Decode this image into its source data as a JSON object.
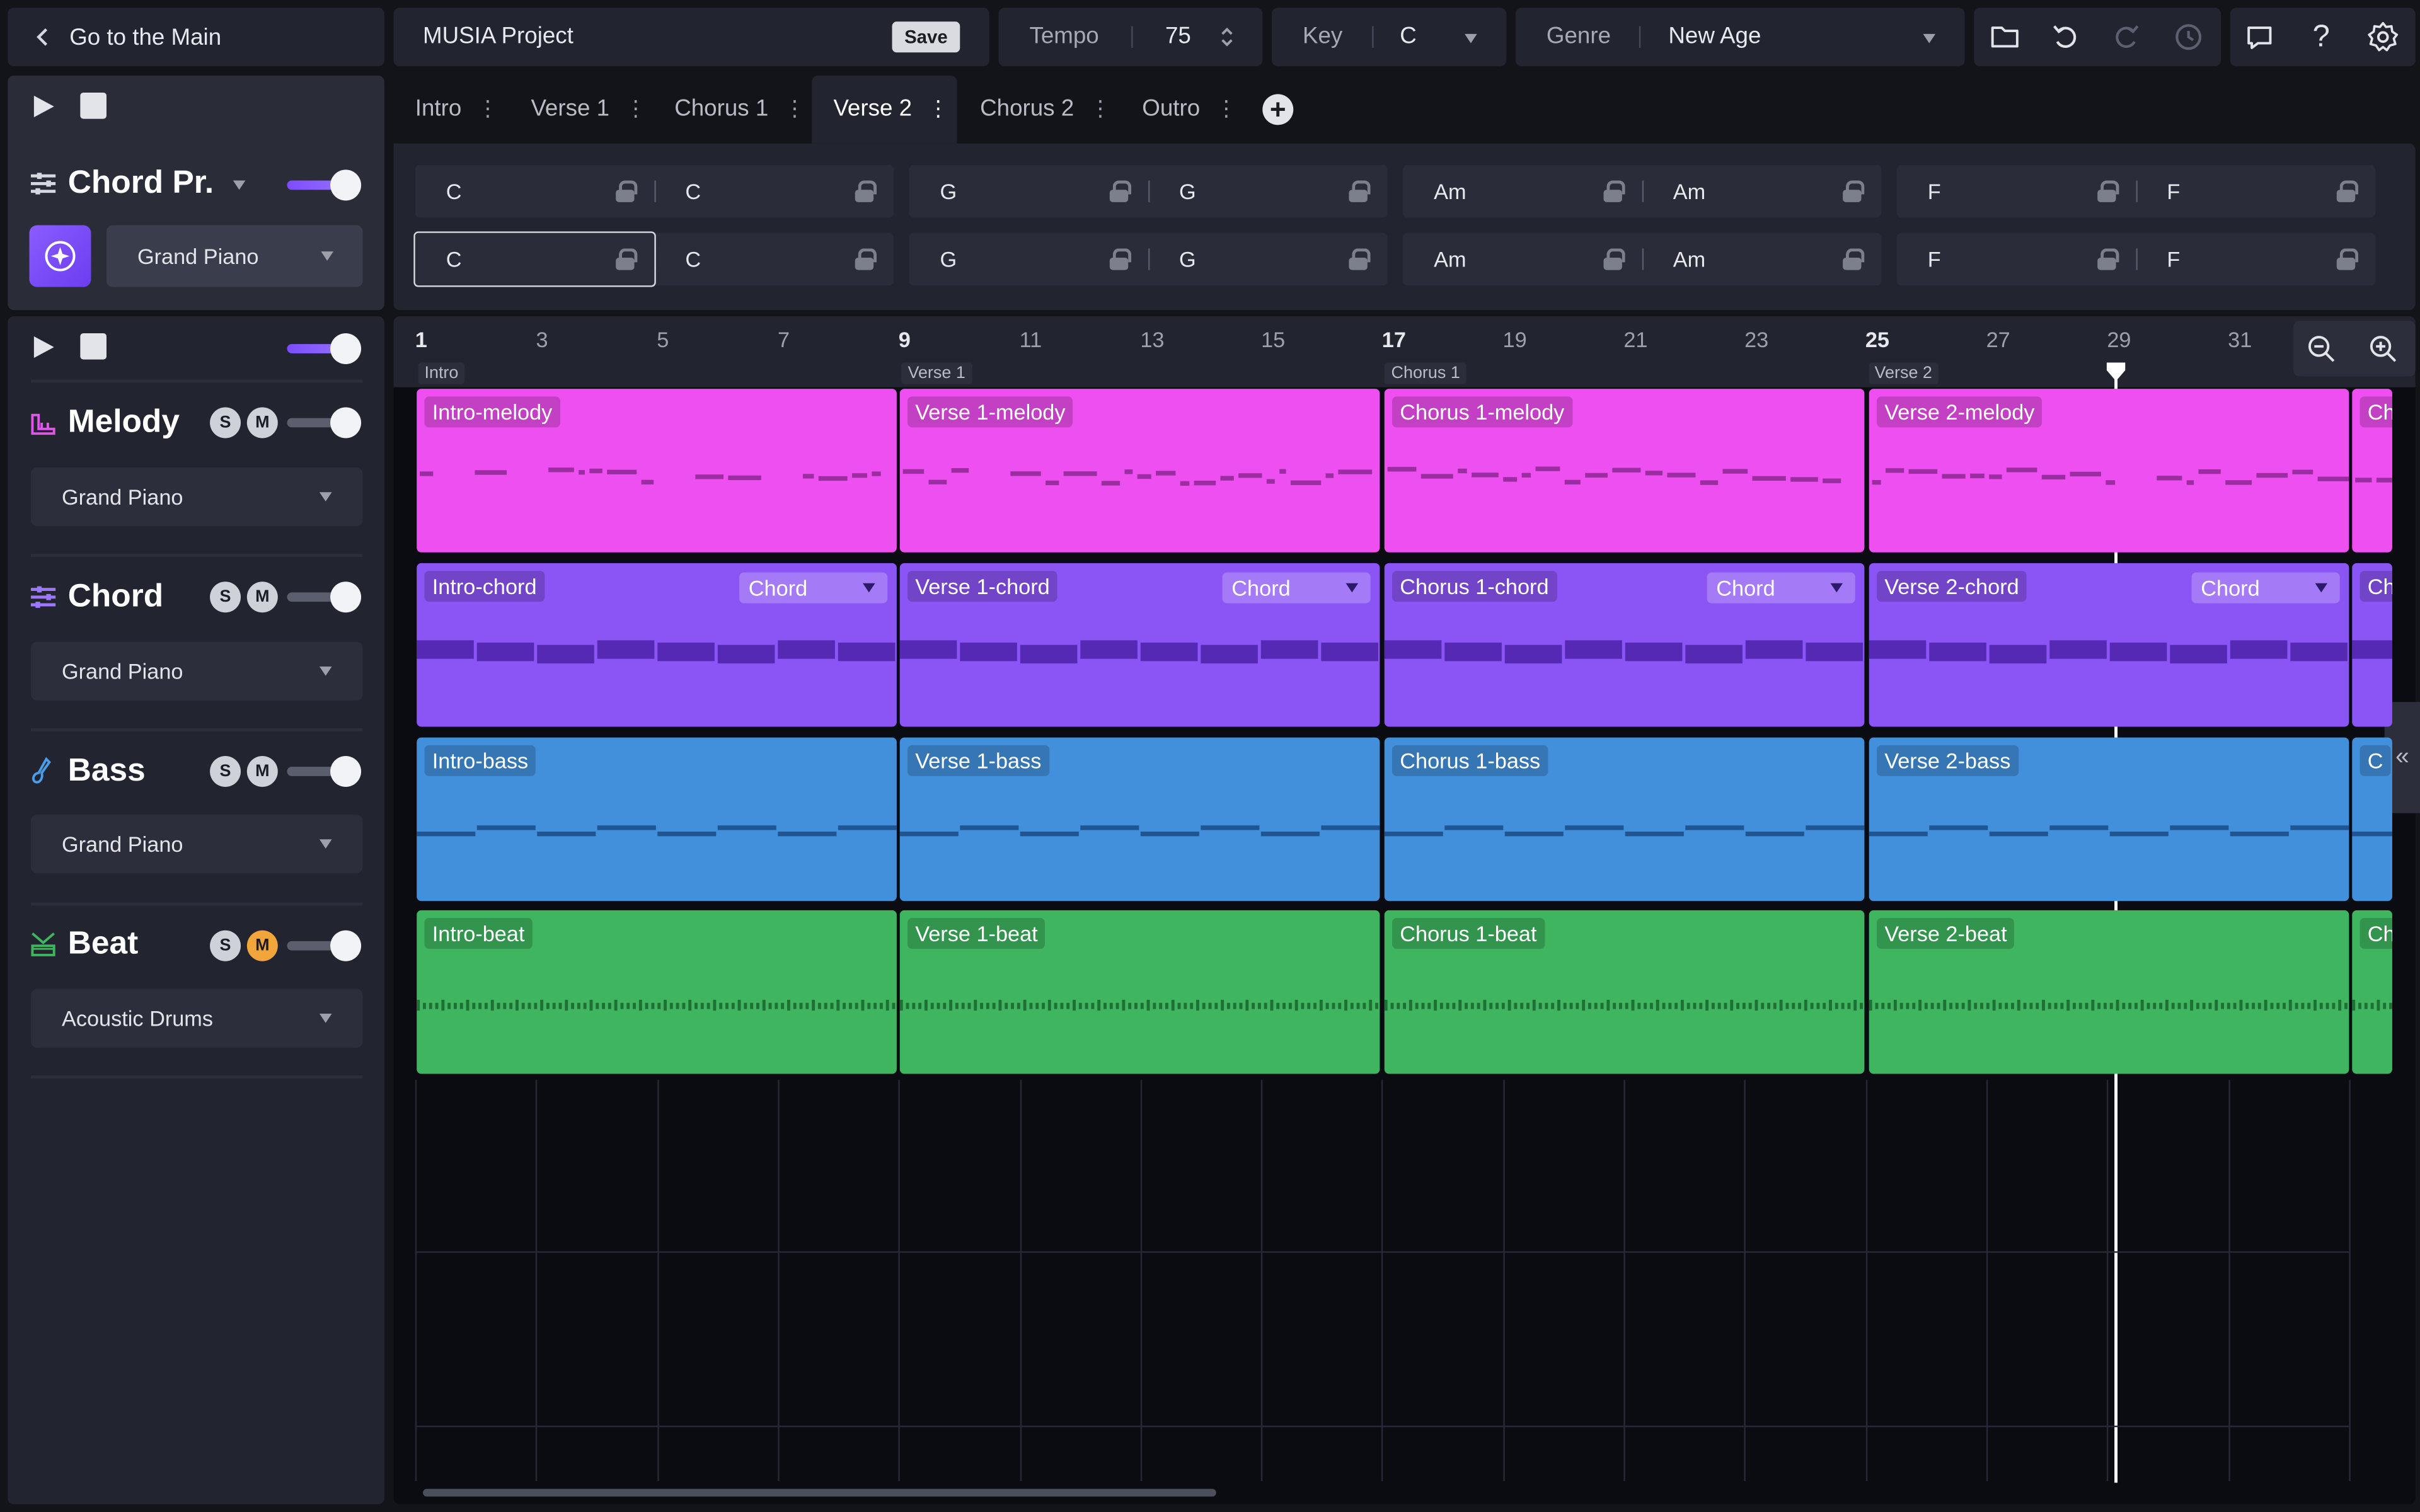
{
  "header": {
    "back_label": "Go to the Main",
    "project_name": "MUSIA Project",
    "save_label": "Save",
    "tempo_label": "Tempo",
    "tempo_value": "75",
    "key_label": "Key",
    "key_value": "C",
    "genre_label": "Genre",
    "genre_value": "New Age"
  },
  "tabs": [
    {
      "label": "Intro"
    },
    {
      "label": "Verse 1"
    },
    {
      "label": "Chorus 1"
    },
    {
      "label": "Verse 2",
      "active": true
    },
    {
      "label": "Chorus 2"
    },
    {
      "label": "Outro"
    }
  ],
  "chord_progression": {
    "title": "Chord Pr.",
    "instrument": "Grand Piano",
    "rows": [
      [
        "C",
        "C",
        "G",
        "G",
        "Am",
        "Am",
        "F",
        "F"
      ],
      [
        "C",
        "C",
        "G",
        "G",
        "Am",
        "Am",
        "F",
        "F"
      ]
    ]
  },
  "tracks": [
    {
      "name": "Melody",
      "instrument": "Grand Piano",
      "solo": "S",
      "mute": "M"
    },
    {
      "name": "Chord",
      "instrument": "Grand Piano",
      "solo": "S",
      "mute": "M"
    },
    {
      "name": "Bass",
      "instrument": "Grand Piano",
      "solo": "S",
      "mute": "M"
    },
    {
      "name": "Beat",
      "instrument": "Acoustic Drums",
      "solo": "S",
      "mute": "M",
      "mute_active": true
    }
  ],
  "ruler": {
    "numbers": [
      "1",
      "3",
      "5",
      "7",
      "9",
      "11",
      "13",
      "15",
      "17",
      "19",
      "21",
      "23",
      "25",
      "27",
      "29",
      "31"
    ],
    "sections": [
      "Intro",
      "Verse 1",
      "Chorus 1",
      "Verse 2"
    ]
  },
  "clips": {
    "melody": [
      "Intro-melody",
      "Verse 1-melody",
      "Chorus 1-melody",
      "Verse 2-melody",
      "Ch"
    ],
    "chord": [
      "Intro-chord",
      "Verse 1-chord",
      "Chorus 1-chord",
      "Verse 2-chord",
      "Ch"
    ],
    "chord_dropdown": "Chord",
    "bass": [
      "Intro-bass",
      "Verse 1-bass",
      "Chorus 1-bass",
      "Verse 2-bass",
      "C"
    ],
    "beat": [
      "Intro-beat",
      "Verse 1-beat",
      "Chorus 1-beat",
      "Verse 2-beat",
      "Ch"
    ]
  },
  "colors": {
    "melody": "#ee4ff0",
    "chord": "#8b55f5",
    "bass": "#4290dc",
    "beat": "#3fb55f",
    "accent": "#7c4dff"
  }
}
